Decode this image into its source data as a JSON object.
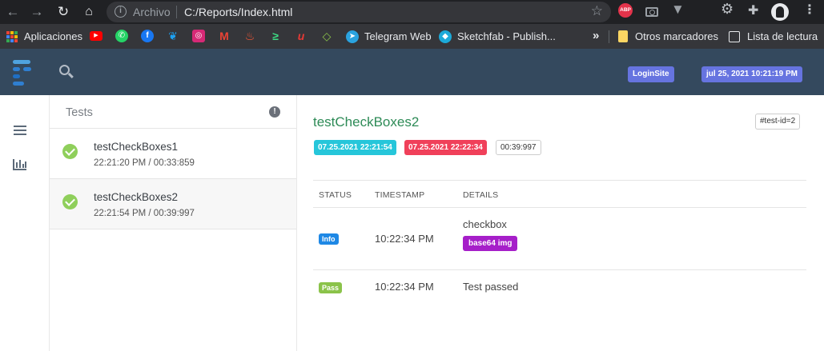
{
  "browser": {
    "scheme_label": "Archivo",
    "url": "C:/Reports/Index.html",
    "extensions": {
      "abp": "ABP"
    },
    "bookmarks": [
      {
        "label": "Aplicaciones"
      },
      {
        "label": "Telegram Web"
      },
      {
        "label": "Sketchfab - Publish..."
      }
    ],
    "other_bookmarks": "Otros marcadores",
    "reading_list": "Lista de lectura"
  },
  "header": {
    "login_badge": "LoginSite",
    "datetime_badge": "jul 25, 2021 10:21:19 PM"
  },
  "test_list": {
    "title": "Tests",
    "items": [
      {
        "name": "testCheckBoxes1",
        "time": "22:21:20 PM / 00:33:859",
        "status": "pass"
      },
      {
        "name": "testCheckBoxes2",
        "time": "22:21:54 PM / 00:39:997",
        "status": "pass"
      }
    ]
  },
  "detail": {
    "title": "testCheckBoxes2",
    "test_id": "#test-id=2",
    "start": "07.25.2021 22:21:54",
    "end": "07.25.2021 22:22:34",
    "duration": "00:39:997",
    "columns": {
      "status": "STATUS",
      "timestamp": "TIMESTAMP",
      "details": "DETAILS"
    },
    "logs": [
      {
        "status": "Info",
        "timestamp": "10:22:34 PM",
        "details": "checkbox",
        "attachment": "base64 img"
      },
      {
        "status": "Pass",
        "timestamp": "10:22:34 PM",
        "details": "Test passed"
      }
    ]
  },
  "colors": {
    "header_bg": "#34495e",
    "pass_green": "#8fcf5b",
    "title_green": "#2e8b57",
    "start_badge": "#26c6da",
    "end_badge": "#f0405a",
    "info_badge": "#1e88e5",
    "img_badge": "#a61fc9",
    "header_badge": "#6674e0"
  }
}
